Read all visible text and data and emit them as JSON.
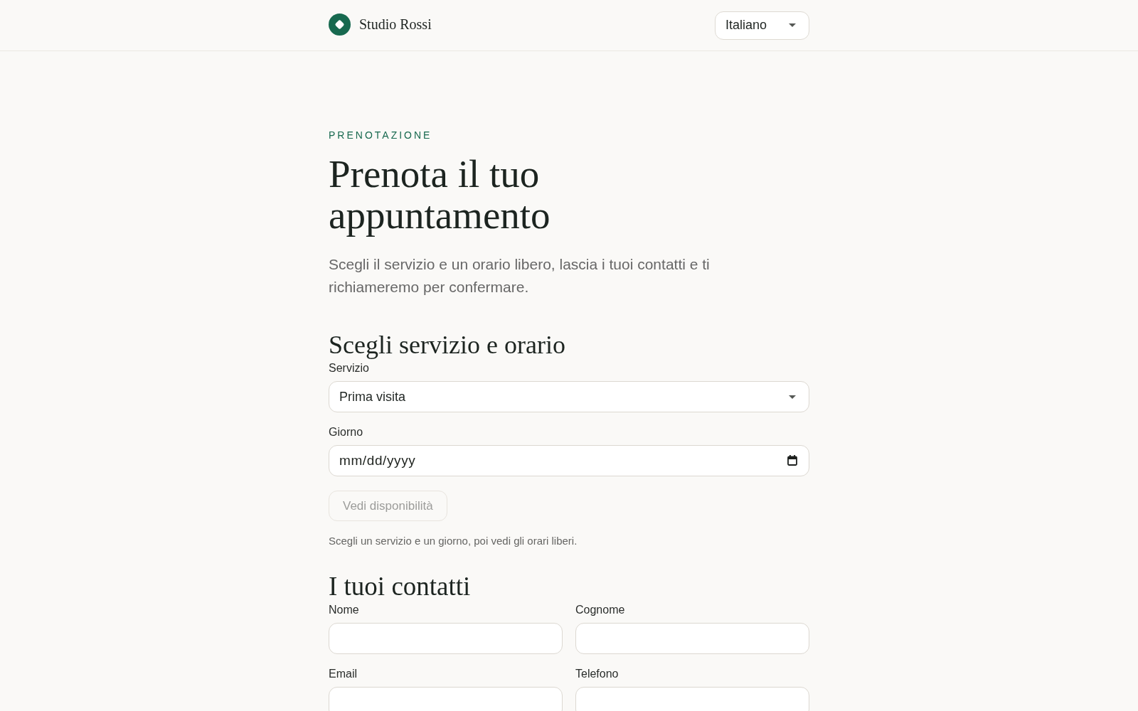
{
  "header": {
    "brand": "Studio Rossi",
    "language": "Italiano"
  },
  "intro": {
    "eyebrow": "PRENOTAZIONE",
    "title": "Prenota il tuo appuntamento",
    "description": "Scegli il servizio e un orario libero, lascia i tuoi contatti e ti richiameremo per confermare."
  },
  "schedule": {
    "title": "Scegli servizio e orario",
    "fields": [
      {
        "kind": "select",
        "label": "Servizio",
        "value": "Prima visita"
      },
      {
        "kind": "date",
        "label": "Giorno",
        "placeholder": "mm/dd/yyyy"
      }
    ],
    "button": {
      "label": "Vedi disponibilità",
      "disabled": true
    },
    "hint": "Scegli un servizio e un giorno, poi vedi gli orari liberi."
  },
  "contacts": {
    "title": "I tuoi contatti",
    "fields": [
      {
        "kind": "text",
        "label": "Nome"
      },
      {
        "kind": "text",
        "label": "Cognome"
      },
      {
        "kind": "text",
        "label": "Email"
      },
      {
        "kind": "text",
        "label": "Telefono"
      }
    ]
  }
}
